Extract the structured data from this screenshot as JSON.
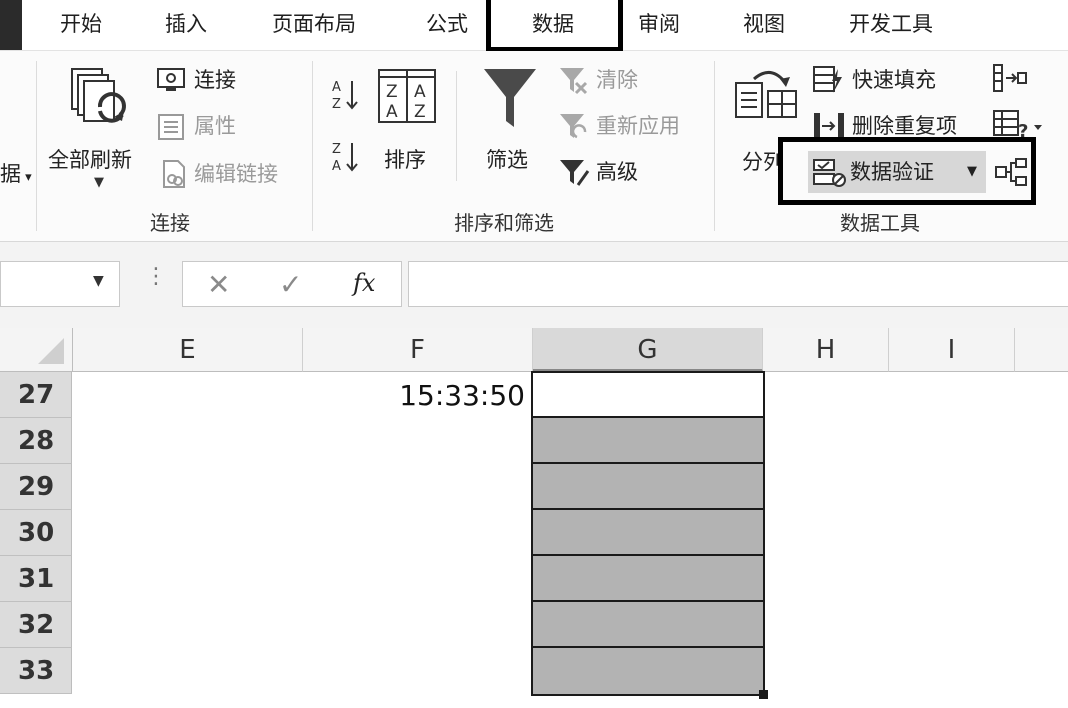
{
  "tabs": {
    "home": "开始",
    "insert": "插入",
    "page_layout": "页面布局",
    "formulas": "公式",
    "data": "数据",
    "review": "审阅",
    "view": "视图",
    "developer": "开发工具"
  },
  "ribbon": {
    "left_cut_label": "据",
    "connections": {
      "refresh_all": "全部刷新",
      "connections": "连接",
      "properties": "属性",
      "edit_links": "编辑链接",
      "group_label": "连接"
    },
    "sort_filter": {
      "sort": "排序",
      "filter": "筛选",
      "clear": "清除",
      "reapply": "重新应用",
      "advanced": "高级",
      "group_label": "排序和筛选"
    },
    "data_tools": {
      "text_to_columns": "分列",
      "flash_fill": "快速填充",
      "remove_duplicates": "删除重复项",
      "data_validation": "数据验证",
      "group_label": "数据工具"
    }
  },
  "formula_bar": {
    "fx": "fx",
    "name_box_value": "",
    "formula_value": ""
  },
  "grid": {
    "columns": [
      "E",
      "F",
      "G",
      "H",
      "I"
    ],
    "selected_column": "G",
    "rows": [
      "27",
      "28",
      "29",
      "30",
      "31",
      "32",
      "33"
    ],
    "cells": {
      "F27": "15:33:50"
    }
  },
  "colors": {
    "highlight_box": "#000000",
    "selected_fill": "#b3b3b3",
    "header_fill": "#dcdcdc"
  }
}
